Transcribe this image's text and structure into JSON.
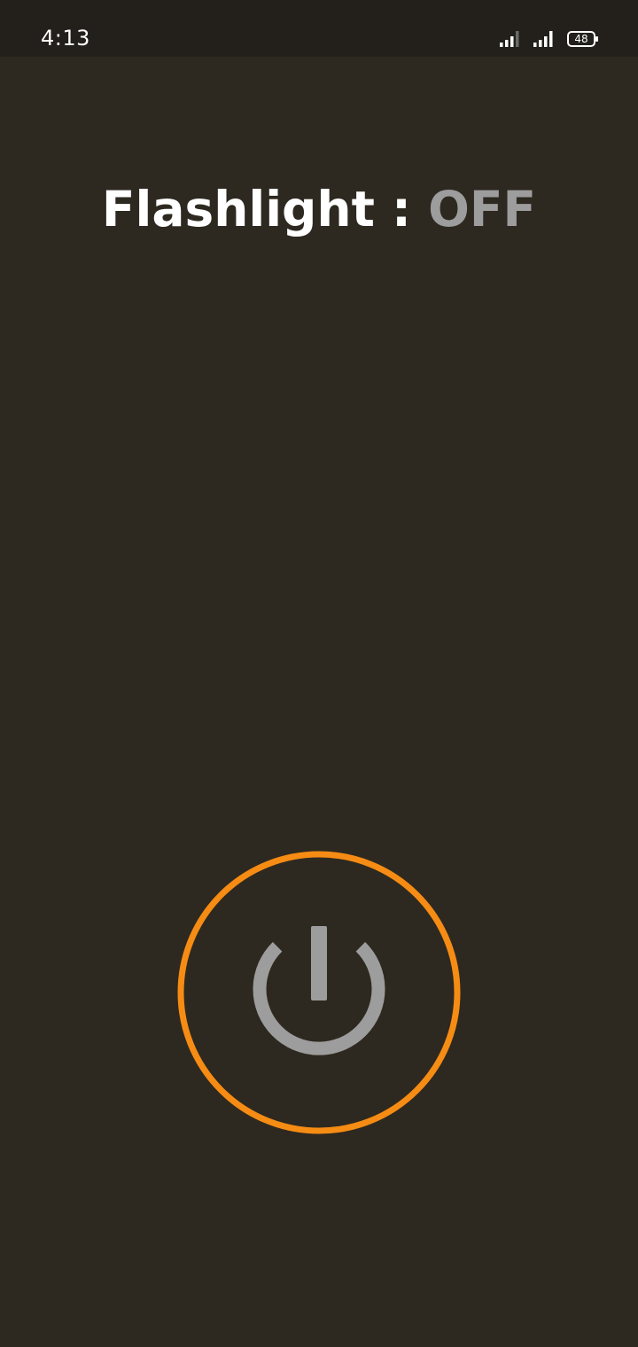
{
  "status_bar": {
    "time": "4:13",
    "battery_level": "48",
    "icons": [
      "signal-icon",
      "signal-icon",
      "battery-icon"
    ]
  },
  "header": {
    "label": "Flashlight : ",
    "state": "OFF"
  },
  "power_button": {
    "icon": "power-icon"
  },
  "colors": {
    "background": "#2e2920",
    "status_bar": "#23201b",
    "accent_ring": "#f68c14",
    "power_icon": "#9d9d9d",
    "title_text": "#ffffff",
    "state_text": "#9d9d9d"
  }
}
